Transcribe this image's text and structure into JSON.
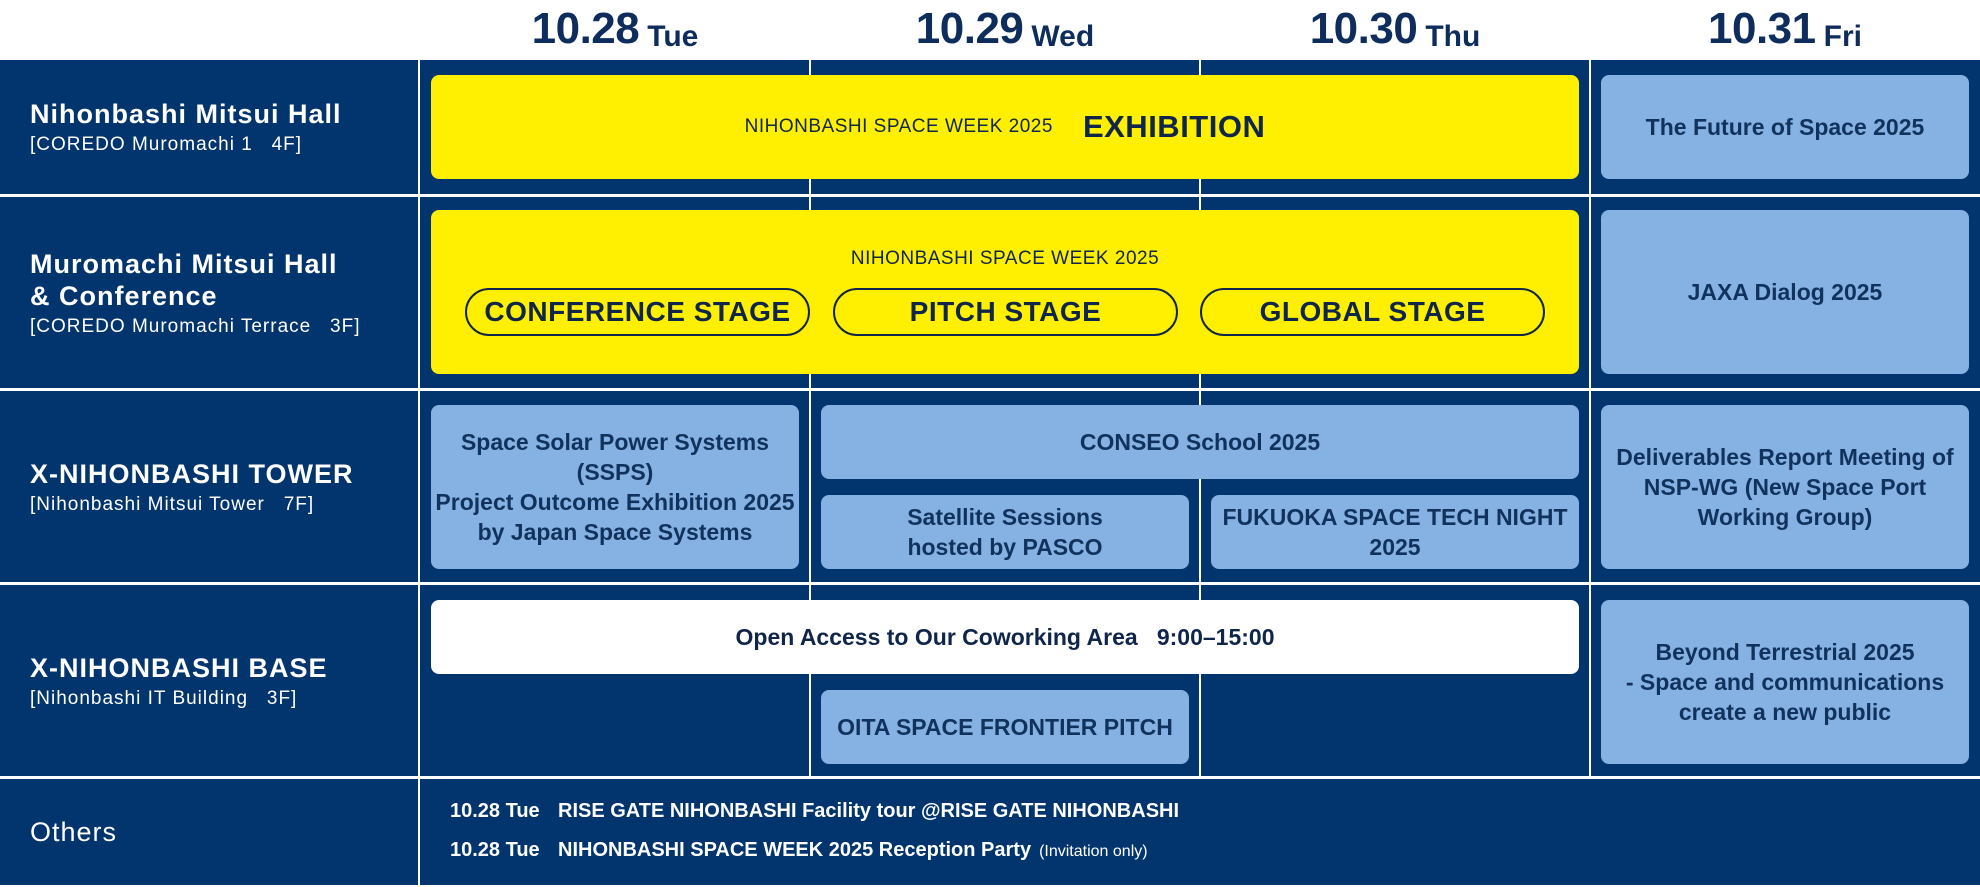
{
  "days": [
    {
      "date": "10.28",
      "weekday": "Tue"
    },
    {
      "date": "10.29",
      "weekday": "Wed"
    },
    {
      "date": "10.30",
      "weekday": "Thu"
    },
    {
      "date": "10.31",
      "weekday": "Fri"
    }
  ],
  "venues": [
    {
      "name": "Nihonbashi Mitsui Hall",
      "location": "[COREDO Muromachi 1   4F]"
    },
    {
      "name": "Muromachi Mitsui Hall\n& Conference",
      "location": "[COREDO Muromachi Terrace   3F]"
    },
    {
      "name": "X-NIHONBASHI TOWER",
      "location": "[Nihonbashi Mitsui Tower   7F]"
    },
    {
      "name": "X-NIHONBASHI BASE",
      "location": "[Nihonbashi IT Building   3F]"
    },
    {
      "name": "Others",
      "location": ""
    }
  ],
  "events": {
    "exhibition_prefix": "NIHONBASHI SPACE WEEK 2025",
    "exhibition_title": "EXHIBITION",
    "future_of_space": "The Future of Space 2025",
    "stages_prefix": "NIHONBASHI SPACE WEEK 2025",
    "stages": [
      "CONFERENCE STAGE",
      "PITCH STAGE",
      "GLOBAL STAGE"
    ],
    "jaxa_dialog": "JAXA Dialog 2025",
    "ssps": "Space Solar Power Systems (SSPS)\nProject Outcome Exhibition 2025\nby Japan Space Systems",
    "conseo": "CONSEO School 2025",
    "satellite": "Satellite Sessions\nhosted by PASCO",
    "fukuoka": "FUKUOKA SPACE TECH NIGHT\n2025",
    "deliverables": "Deliverables Report Meeting of\nNSP-WG (New Space Port\nWorking Group)",
    "coworking": "Open Access to Our Coworking Area   9:00–15:00",
    "oita": "OITA SPACE FRONTIER PITCH",
    "beyond": "Beyond Terrestrial 2025\n- Space and communications\ncreate a new public"
  },
  "others": [
    {
      "date": "10.28 Tue",
      "text": "RISE GATE NIHONBASHI Facility tour @RISE GATE NIHONBASHI",
      "note": ""
    },
    {
      "date": "10.28 Tue",
      "text": "NIHONBASHI SPACE WEEK 2025 Reception Party",
      "note": "(Invitation only)"
    }
  ],
  "colors": {
    "navy": "#02346e",
    "yellow": "#ffef00",
    "light_blue": "#85b2e3",
    "white": "#ffffff"
  }
}
